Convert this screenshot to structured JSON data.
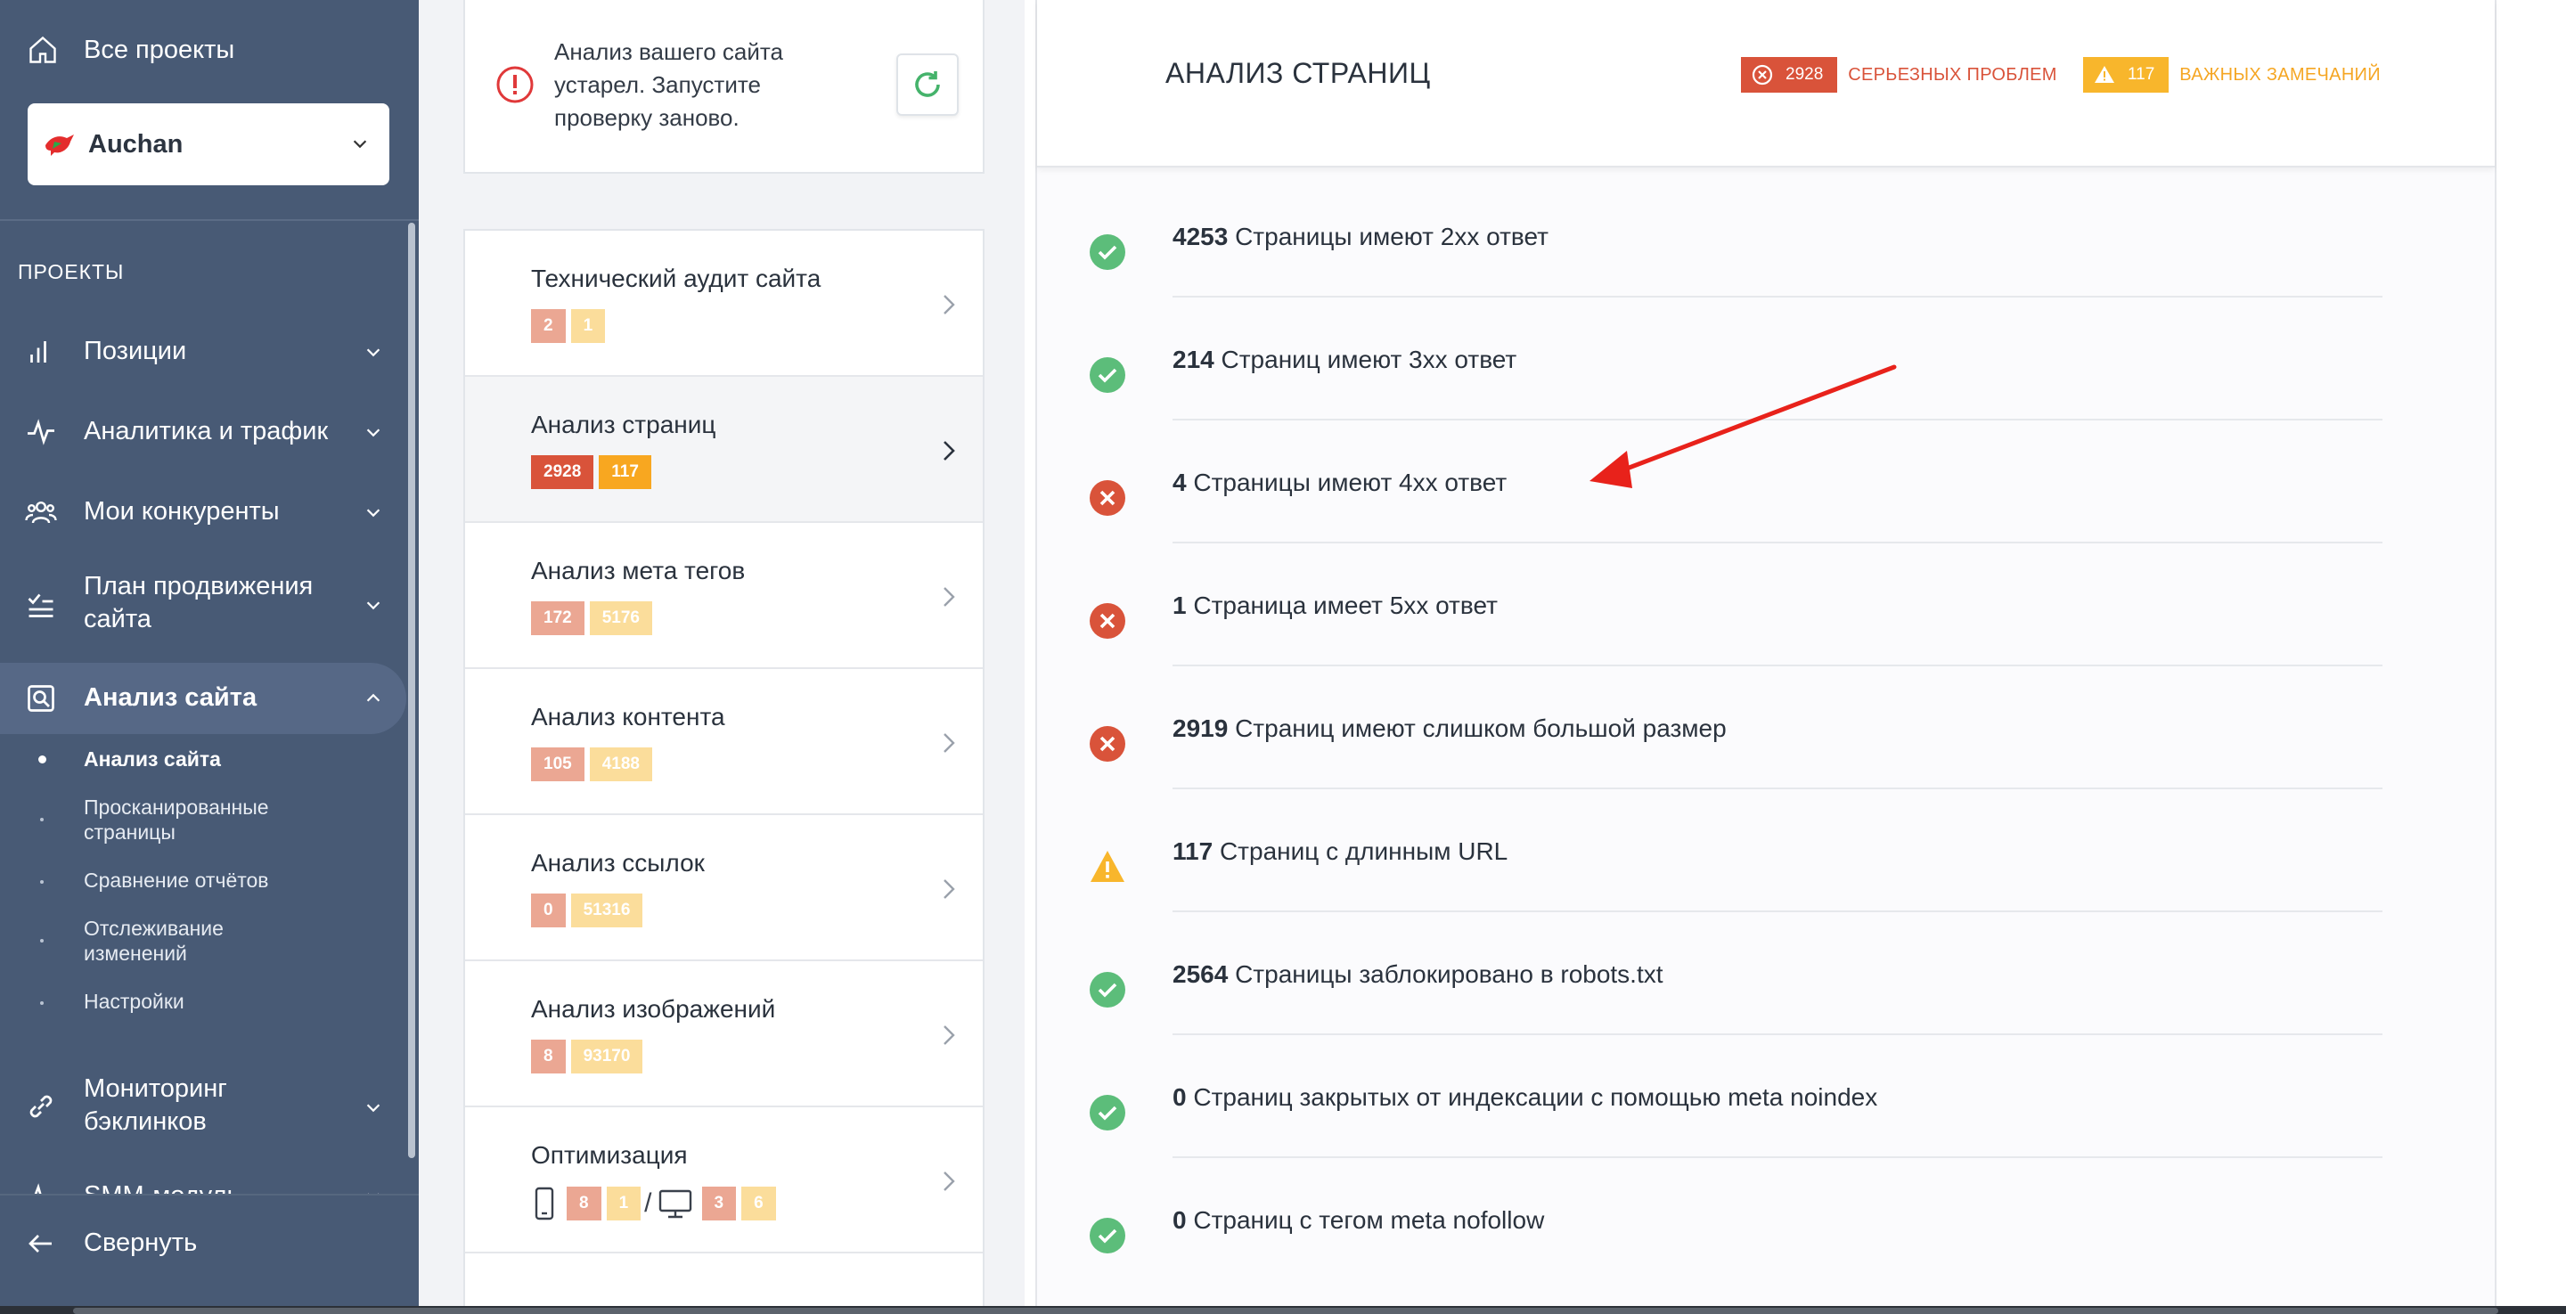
{
  "sidebar": {
    "all_projects": "Все проекты",
    "project": {
      "name": "Auchan"
    },
    "section_label": "ПРОЕКТЫ",
    "items": [
      {
        "label": "Позиции",
        "icon": "bar-chart-icon"
      },
      {
        "label": "Аналитика и трафик",
        "icon": "pulse-icon"
      },
      {
        "label": "Мои конкуренты",
        "icon": "users-icon"
      },
      {
        "label": "План продвижения сайта",
        "icon": "checklist-icon"
      },
      {
        "label": "Анализ сайта",
        "icon": "site-search-icon"
      },
      {
        "label": "Мониторинг бэклинков",
        "icon": "link-icon"
      },
      {
        "label": "SMM-модуль",
        "icon": "pulse-icon"
      }
    ],
    "subitems": [
      {
        "label": "Анализ сайта"
      },
      {
        "label": "Просканированные страницы"
      },
      {
        "label": "Сравнение отчётов"
      },
      {
        "label": "Отслеживание изменений"
      },
      {
        "label": "Настройки"
      }
    ],
    "collapse": "Свернуть"
  },
  "alert": {
    "text": "Анализ вашего сайта устарел. Запустите проверку заново."
  },
  "cards": [
    {
      "title": "Технический аудит сайта",
      "errors": "2",
      "warnings": "1"
    },
    {
      "title": "Анализ страниц",
      "errors": "2928",
      "warnings": "117"
    },
    {
      "title": "Анализ мета тегов",
      "errors": "172",
      "warnings": "5176"
    },
    {
      "title": "Анализ контента",
      "errors": "105",
      "warnings": "4188"
    },
    {
      "title": "Анализ ссылок",
      "errors": "0",
      "warnings": "51316"
    },
    {
      "title": "Анализ изображений",
      "errors": "8",
      "warnings": "93170"
    },
    {
      "title": "Оптимизация",
      "mobile_errors": "8",
      "mobile_warnings": "1",
      "desktop_errors": "3",
      "desktop_warnings": "6",
      "separator": "/"
    }
  ],
  "panel": {
    "title": "АНАЛИЗ СТРАНИЦ",
    "serious_count": "2928",
    "serious_label": "СЕРЬЕЗНЫХ ПРОБЛЕМ",
    "important_count": "117",
    "important_label": "ВАЖНЫХ ЗАМЕЧАНИЙ",
    "rows": [
      {
        "status": "ok",
        "count": "4253",
        "text": "Страницы имеют 2xx ответ"
      },
      {
        "status": "ok",
        "count": "214",
        "text": "Страниц имеют 3xx ответ"
      },
      {
        "status": "error",
        "count": "4",
        "text": "Страницы имеют 4xx ответ"
      },
      {
        "status": "error",
        "count": "1",
        "text": "Страница имеет 5xx ответ"
      },
      {
        "status": "error",
        "count": "2919",
        "text": "Страниц имеют слишком большой размер"
      },
      {
        "status": "warning",
        "count": "117",
        "text": "Страниц с длинным URL"
      },
      {
        "status": "ok",
        "count": "2564",
        "text": "Страницы заблокировано в robots.txt"
      },
      {
        "status": "ok",
        "count": "0",
        "text": "Страниц закрытых от индексации с помощью meta noindex"
      },
      {
        "status": "ok",
        "count": "0",
        "text": "Страниц с тегом meta nofollow"
      }
    ]
  },
  "colors": {
    "sidebar": "#485a75",
    "error": "#d9533a",
    "warning": "#f8a720",
    "ok": "#5cbd7a",
    "annotation_arrow": "#e8221b"
  }
}
